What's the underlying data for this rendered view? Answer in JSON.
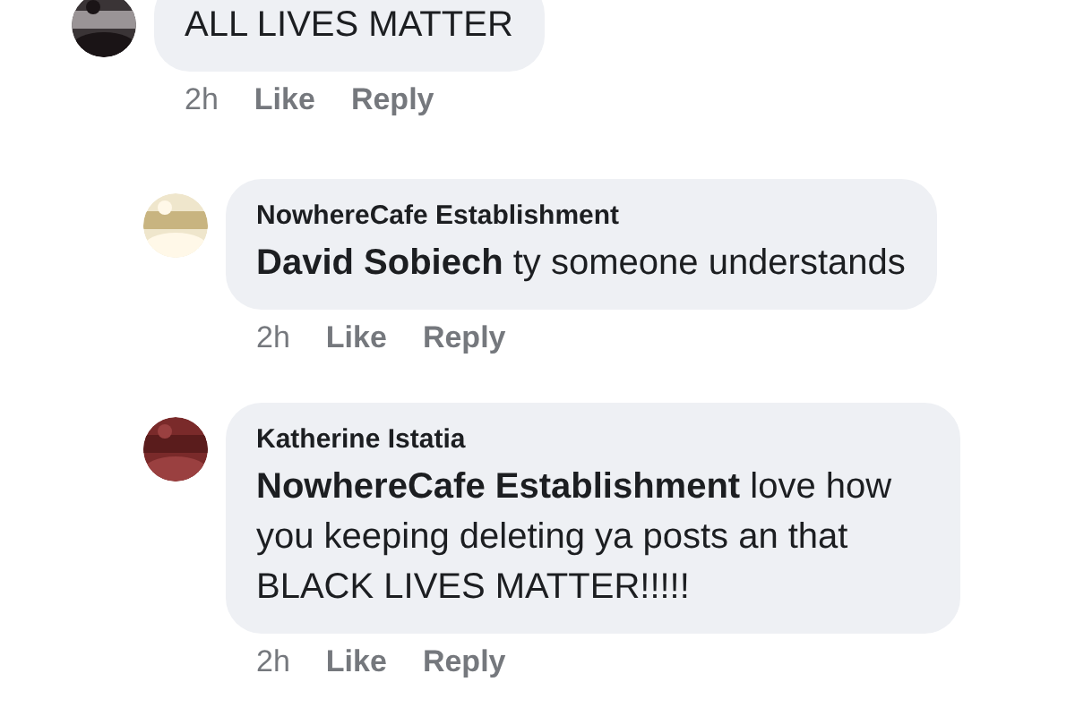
{
  "comments": [
    {
      "body": "ALL LIVES MATTER",
      "meta": {
        "time": "2h",
        "actions": [
          "Like",
          "Reply"
        ]
      },
      "children": [
        {
          "author": "NowhereCafe Establishment",
          "body": "**David Sobiech** ty someone understands",
          "meta": {
            "time": "2h",
            "actions": [
              "Like",
              "Reply"
            ]
          }
        },
        {
          "author": "Katherine Istatia",
          "body": "**NowhereCafe Establishment** love how you keeping deleting ya posts an that BLACK LIVES MATTER!!!!!",
          "meta": {
            "time": "2h",
            "actions": [
              "Like",
              "Reply"
            ]
          }
        }
      ]
    }
  ]
}
